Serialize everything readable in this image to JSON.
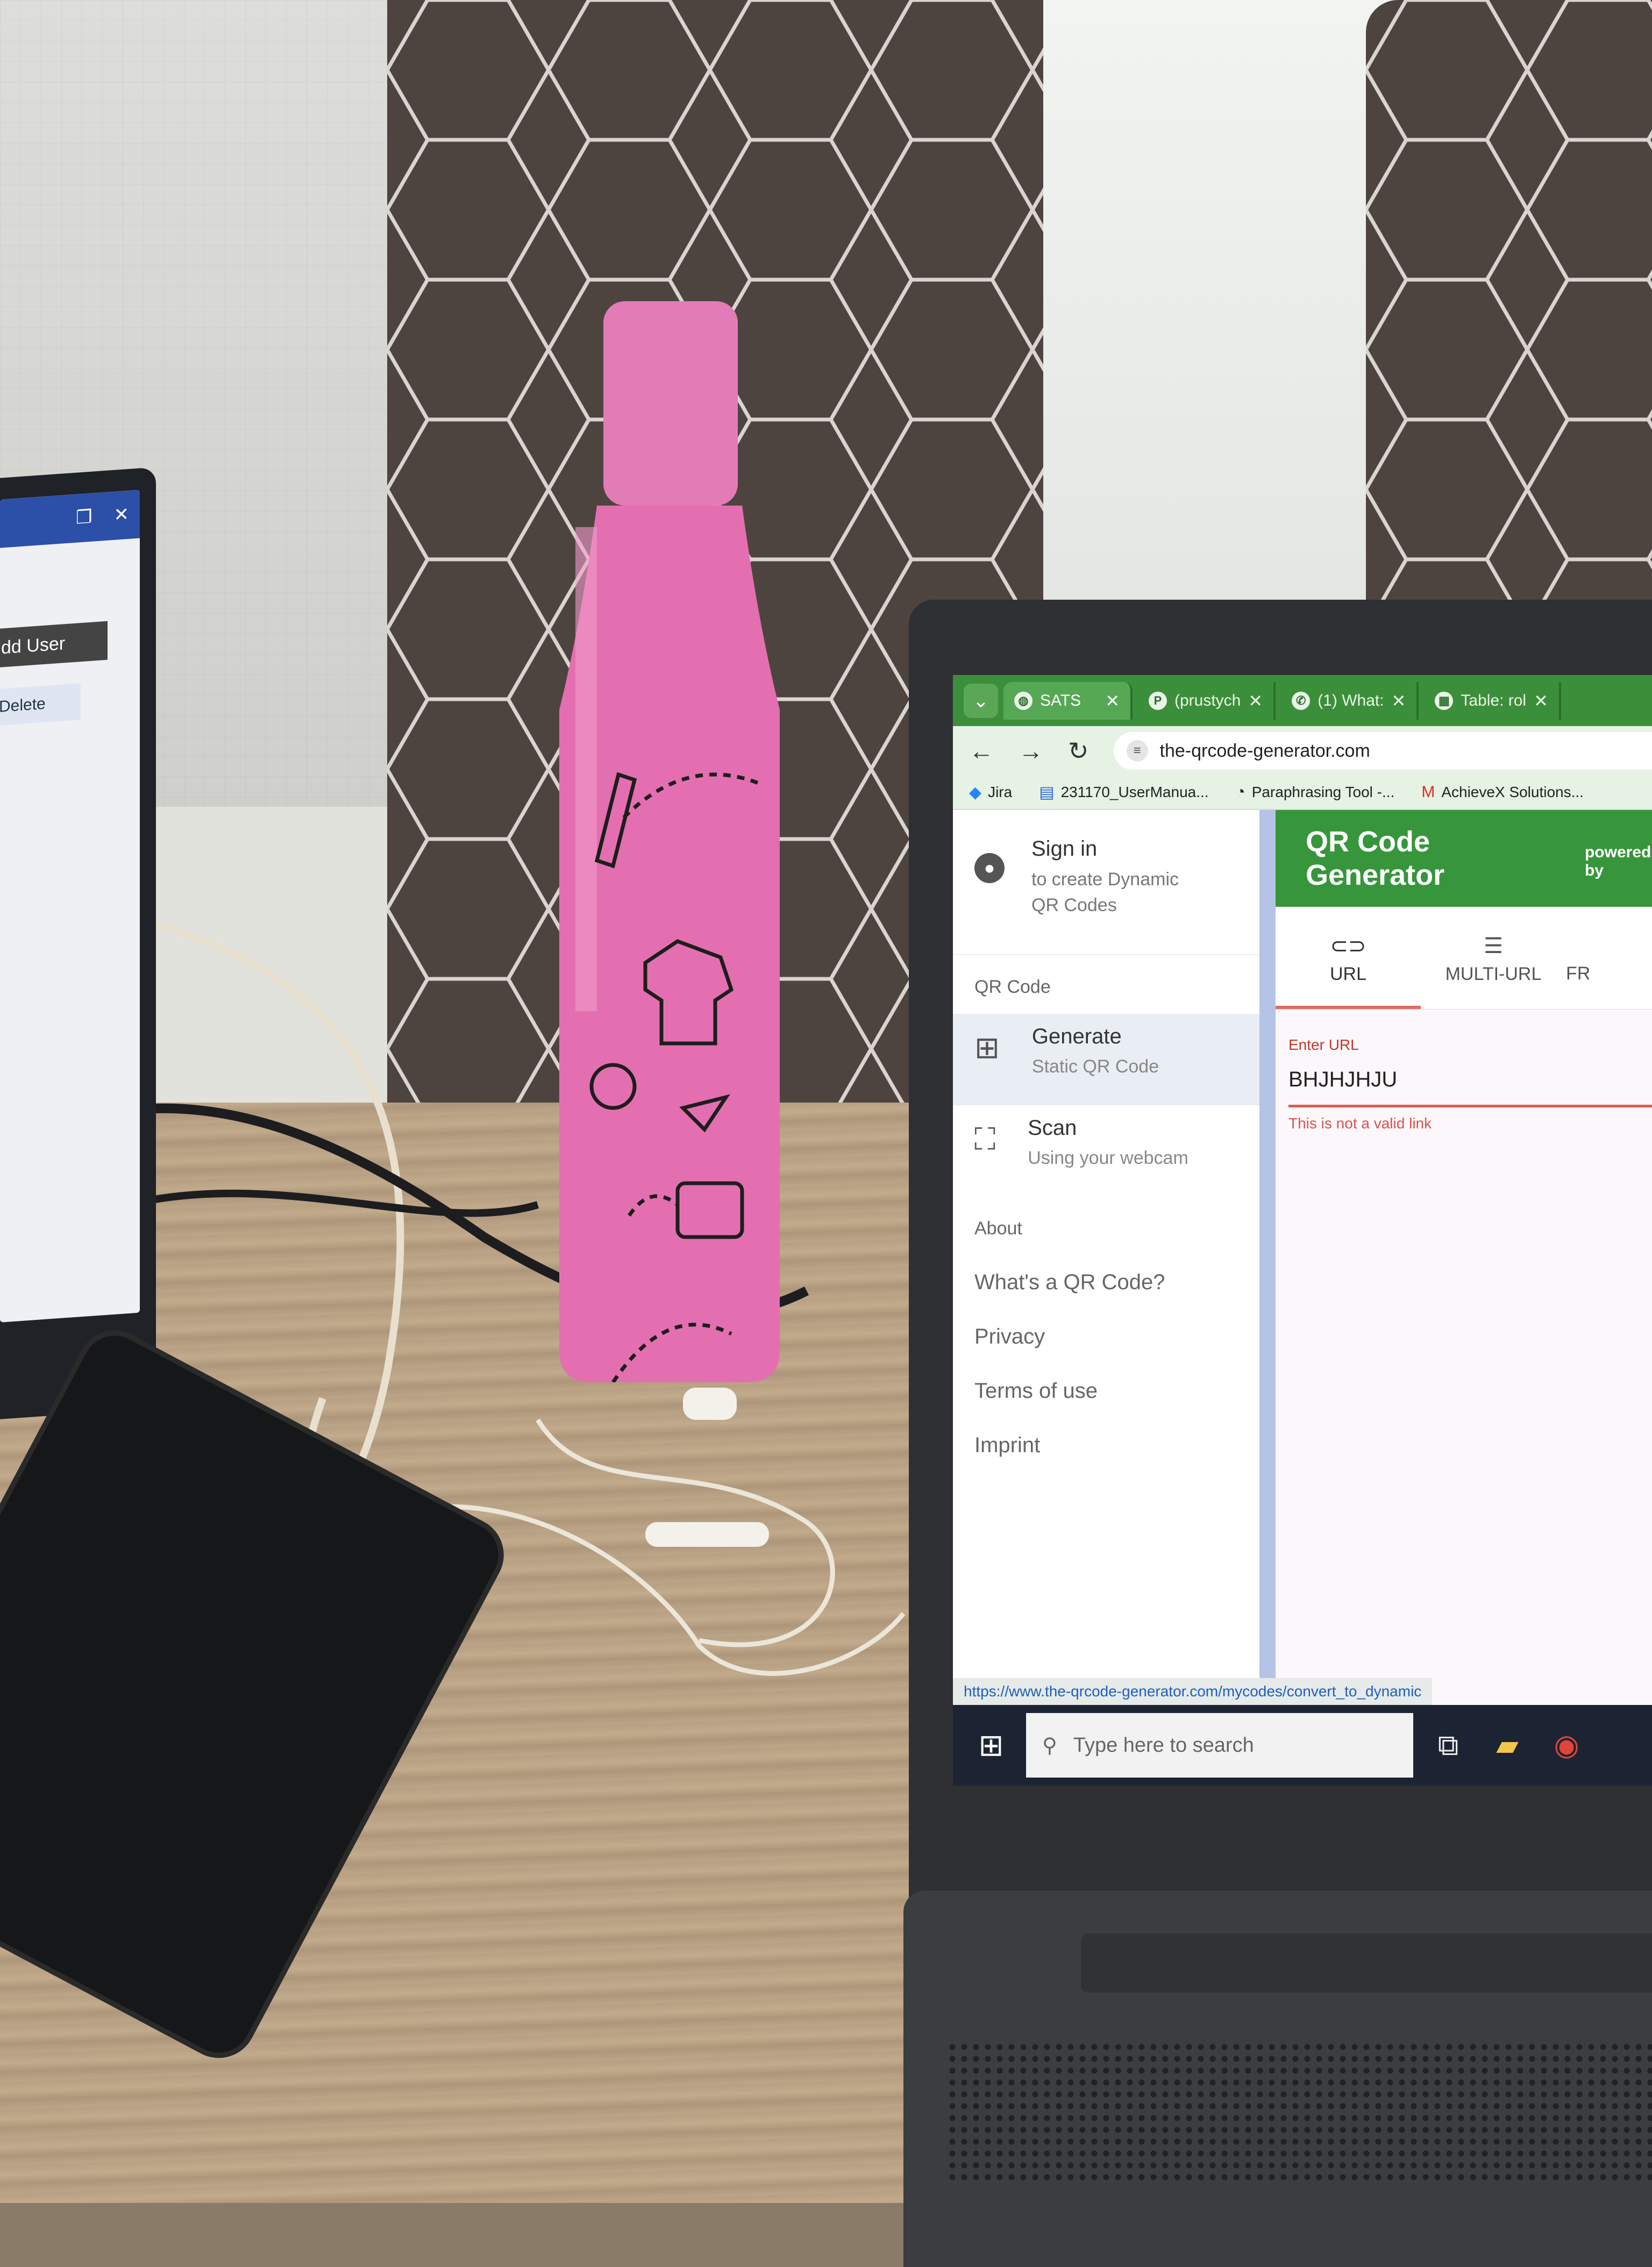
{
  "browser": {
    "tabs": [
      {
        "label": "SATS",
        "icon": "globe-icon",
        "active": true
      },
      {
        "label": "(prustych",
        "icon": "p-app-icon",
        "active": false
      },
      {
        "label": "(1) What:",
        "icon": "whatsapp-icon",
        "active": false
      },
      {
        "label": "Table: rol",
        "icon": "table-app-icon",
        "active": false
      }
    ],
    "url": "the-qrcode-generator.com",
    "bookmarks": [
      {
        "label": "Jira",
        "icon": "jira-icon"
      },
      {
        "label": "231170_UserManua...",
        "icon": "doc-icon"
      },
      {
        "label": "Paraphrasing Tool -...",
        "icon": "quill-icon"
      },
      {
        "label": "AchieveX Solutions...",
        "icon": "gmail-icon"
      }
    ],
    "status_url": "https://www.the-qrcode-generator.com/mycodes/convert_to_dynamic"
  },
  "sidebar": {
    "signin_title": "Sign in",
    "signin_sub_1": "to create Dynamic",
    "signin_sub_2": "QR Codes",
    "section_qr": "QR Code",
    "items": [
      {
        "title": "Generate",
        "sub": "Static QR Code",
        "icon": "qr-grid-icon"
      },
      {
        "title": "Scan",
        "sub": "Using your webcam",
        "icon": "scan-icon"
      }
    ],
    "section_about": "About",
    "links": [
      "What's a QR Code?",
      "Privacy",
      "Terms of use",
      "Imprint"
    ]
  },
  "main": {
    "title": "QR Code Generator",
    "powered": "powered by",
    "type_tabs": [
      {
        "label": "URL",
        "icon": "link-icon"
      },
      {
        "label": "MULTI-URL",
        "icon": "list-icon"
      },
      {
        "label": "FR",
        "icon": ""
      }
    ],
    "field_label": "Enter URL",
    "field_value": "BHJHJHJU",
    "field_error": "This is not a valid link"
  },
  "taskbar": {
    "search_placeholder": "Type here to search"
  },
  "left_laptop": {
    "add_user": "dd User",
    "delete": "Delete"
  },
  "colors": {
    "qr_green": "#37963b",
    "error_red": "#e05a52",
    "bottle_pink": "#e46fb0"
  }
}
